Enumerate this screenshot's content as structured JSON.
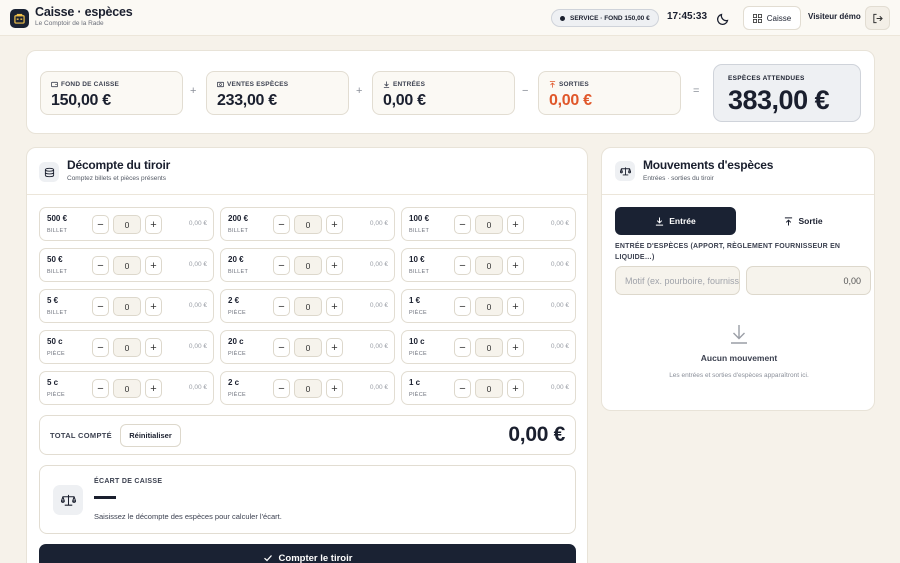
{
  "header": {
    "app_title": "Caisse · espèces",
    "subtitle": "Le Comptoir de la Rade",
    "service_badge": "SERVICE · FOND 150,00 €",
    "clock": "17:45:33",
    "caisse_label": "Caisse",
    "user_name": "Visiteur démo"
  },
  "summary": {
    "fond": {
      "label": "FOND DE CAISSE",
      "value": "150,00 €"
    },
    "ventes": {
      "label": "VENTES ESPÈCES",
      "value": "233,00 €"
    },
    "entrees": {
      "label": "ENTRÉES",
      "value": "0,00 €"
    },
    "sorties": {
      "label": "SORTIES",
      "value": "0,00 €"
    },
    "ops": [
      "+",
      "+",
      "−",
      "="
    ],
    "expected": {
      "label": "ESPÈCES ATTENDUES",
      "value": "383,00 €"
    }
  },
  "drawer": {
    "title": "Décompte du tiroir",
    "subtitle": "Comptez billets et pièces présents",
    "denominations": [
      {
        "name": "500 €",
        "kind": "BILLET",
        "qty": "0",
        "amount": "0,00 €"
      },
      {
        "name": "200 €",
        "kind": "BILLET",
        "qty": "0",
        "amount": "0,00 €"
      },
      {
        "name": "100 €",
        "kind": "BILLET",
        "qty": "0",
        "amount": "0,00 €"
      },
      {
        "name": "50 €",
        "kind": "BILLET",
        "qty": "0",
        "amount": "0,00 €"
      },
      {
        "name": "20 €",
        "kind": "BILLET",
        "qty": "0",
        "amount": "0,00 €"
      },
      {
        "name": "10 €",
        "kind": "BILLET",
        "qty": "0",
        "amount": "0,00 €"
      },
      {
        "name": "5 €",
        "kind": "BILLET",
        "qty": "0",
        "amount": "0,00 €"
      },
      {
        "name": "2 €",
        "kind": "PIÈCE",
        "qty": "0",
        "amount": "0,00 €"
      },
      {
        "name": "1 €",
        "kind": "PIÈCE",
        "qty": "0",
        "amount": "0,00 €"
      },
      {
        "name": "50 c",
        "kind": "PIÈCE",
        "qty": "0",
        "amount": "0,00 €"
      },
      {
        "name": "20 c",
        "kind": "PIÈCE",
        "qty": "0",
        "amount": "0,00 €"
      },
      {
        "name": "10 c",
        "kind": "PIÈCE",
        "qty": "0",
        "amount": "0,00 €"
      },
      {
        "name": "5 c",
        "kind": "PIÈCE",
        "qty": "0",
        "amount": "0,00 €"
      },
      {
        "name": "2 c",
        "kind": "PIÈCE",
        "qty": "0",
        "amount": "0,00 €"
      },
      {
        "name": "1 c",
        "kind": "PIÈCE",
        "qty": "0",
        "amount": "0,00 €"
      }
    ],
    "total_label": "TOTAL COMPTÉ",
    "reset_label": "Réinitialiser",
    "total_value": "0,00 €",
    "ecart_label": "ÉCART DE CAISSE",
    "ecart_hint": "Saisissez le décompte des espèces pour calculer l'écart.",
    "count_button": "Compter le tiroir"
  },
  "movements": {
    "title": "Mouvements d'espèces",
    "subtitle": "Entrées · sorties du tiroir",
    "tab_in": "Entrée",
    "tab_out": "Sortie",
    "field_label": "ENTRÉE D'ESPÈCES (APPORT, RÈGLEMENT FOURNISSEUR EN LIQUIDE…)",
    "motif_placeholder": "Motif (ex. pourboire, fournisseur…)",
    "amount_value": "0,00",
    "empty_title": "Aucun mouvement",
    "empty_sub": "Les entrées et sorties d'espèces apparaîtront ici."
  },
  "colors": {
    "accent": "#1a2233",
    "sorties": "#e0572a",
    "background": "#f6f2ea"
  }
}
